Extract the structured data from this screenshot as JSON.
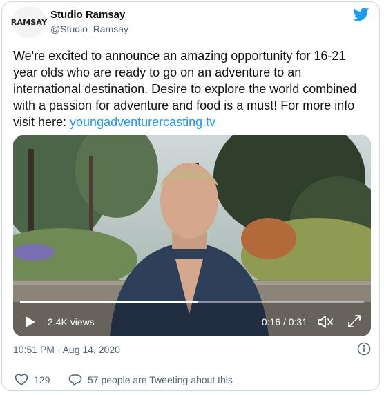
{
  "account": {
    "avatar_text": "RAMSAY",
    "name": "Studio Ramsay",
    "handle": "@Studio_Ramsay"
  },
  "tweet": {
    "text": "We're excited to announce an amazing opportunity for 16-21 year olds who are ready to go on an adventure to an international destination. Desire to explore the world combined with a passion for adventure and food is a must! For more info visit here: ",
    "link_text": "youngadventurercasting.tv"
  },
  "video": {
    "views": "2.4K views",
    "time": "0:16 / 0:31",
    "progress_fraction": 0.516
  },
  "meta": {
    "timestamp": "10:51 PM · Aug 14, 2020"
  },
  "actions": {
    "likes": "129",
    "replies_text": "57 people are Tweeting about this"
  },
  "colors": {
    "accent": "#1d9bf0",
    "text": "#0f1419",
    "muted": "#536471",
    "like_icon": "#e0245e"
  },
  "icons": [
    "twitter-bird-icon",
    "play-icon",
    "volume-icon",
    "fullscreen-icon",
    "info-icon",
    "heart-icon",
    "reply-bubble-icon"
  ]
}
